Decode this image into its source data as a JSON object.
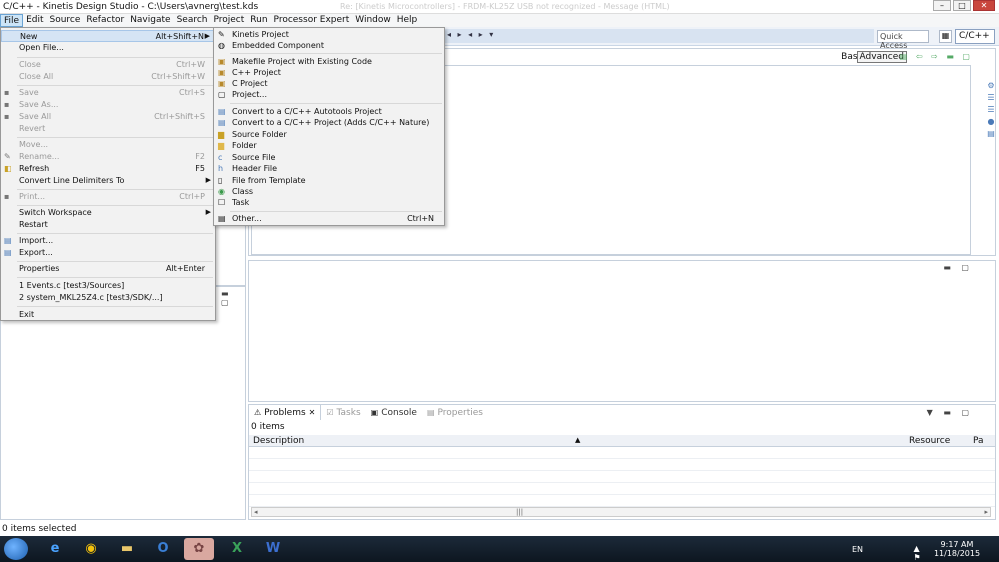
{
  "window": {
    "title": "C/C++ - Kinetis Design Studio - C:\\Users\\avnerg\\test.kds",
    "ghost_text": "Re: [Kinetis Microcontrollers] - FRDM-KL25Z USB not recognized - Message (HTML)",
    "minimize": "–",
    "maximize": "□",
    "close": "✕"
  },
  "menubar": [
    "File",
    "Edit",
    "Source",
    "Refactor",
    "Navigate",
    "Search",
    "Project",
    "Run",
    "Processor Expert",
    "Window",
    "Help"
  ],
  "toolbar": {
    "nav_arrows": "◂ ▸ ◂ ▸ ▾",
    "quick_access": "Quick Access",
    "perspective": "C/C++"
  },
  "file_menu": {
    "items": [
      {
        "label": "New",
        "shortcut": "Alt+Shift+N",
        "submenu": true,
        "enabled": true
      },
      {
        "label": "Open File...",
        "shortcut": "",
        "enabled": true
      },
      {
        "label": "Close",
        "shortcut": "Ctrl+W",
        "enabled": false
      },
      {
        "label": "Close All",
        "shortcut": "Ctrl+Shift+W",
        "enabled": false
      },
      {
        "label": "Save",
        "shortcut": "Ctrl+S",
        "enabled": false
      },
      {
        "label": "Save As...",
        "shortcut": "",
        "enabled": false
      },
      {
        "label": "Save All",
        "shortcut": "Ctrl+Shift+S",
        "enabled": false
      },
      {
        "label": "Revert",
        "shortcut": "",
        "enabled": false
      },
      {
        "label": "Move...",
        "shortcut": "",
        "enabled": false
      },
      {
        "label": "Rename...",
        "shortcut": "F2",
        "enabled": false
      },
      {
        "label": "Refresh",
        "shortcut": "F5",
        "enabled": true
      },
      {
        "label": "Convert Line Delimiters To",
        "shortcut": "",
        "submenu": true,
        "enabled": true
      },
      {
        "label": "Print...",
        "shortcut": "Ctrl+P",
        "enabled": false
      },
      {
        "label": "Switch Workspace",
        "shortcut": "",
        "submenu": true,
        "enabled": true
      },
      {
        "label": "Restart",
        "shortcut": "",
        "enabled": true
      },
      {
        "label": "Import...",
        "shortcut": "",
        "enabled": true
      },
      {
        "label": "Export...",
        "shortcut": "",
        "enabled": true
      },
      {
        "label": "Properties",
        "shortcut": "Alt+Enter",
        "enabled": true
      },
      {
        "label": "1 Events.c  [test3/Sources]",
        "shortcut": "",
        "enabled": true
      },
      {
        "label": "2 system_MKL25Z4.c  [test3/SDK/...]",
        "shortcut": "",
        "enabled": true
      },
      {
        "label": "Exit",
        "shortcut": "",
        "enabled": true
      }
    ]
  },
  "new_submenu": {
    "items": [
      {
        "label": "Kinetis Project",
        "shortcut": "",
        "icon": "wizard-icon"
      },
      {
        "label": "Embedded Component",
        "shortcut": "",
        "icon": "component-icon"
      },
      {
        "label": "Makefile Project with Existing Code",
        "shortcut": "",
        "icon": "makefile-icon"
      },
      {
        "label": "C++ Project",
        "shortcut": "",
        "icon": "cpp-project-icon"
      },
      {
        "label": "C Project",
        "shortcut": "",
        "icon": "c-project-icon"
      },
      {
        "label": "Project...",
        "shortcut": "",
        "icon": "project-icon"
      },
      {
        "label": "Convert to a C/C++ Autotools Project",
        "shortcut": "",
        "icon": "convert-icon"
      },
      {
        "label": "Convert to a C/C++ Project (Adds C/C++ Nature)",
        "shortcut": "",
        "icon": "convert-icon"
      },
      {
        "label": "Source Folder",
        "shortcut": "",
        "icon": "source-folder-icon"
      },
      {
        "label": "Folder",
        "shortcut": "",
        "icon": "folder-icon"
      },
      {
        "label": "Source File",
        "shortcut": "",
        "icon": "source-file-icon"
      },
      {
        "label": "Header File",
        "shortcut": "",
        "icon": "header-file-icon"
      },
      {
        "label": "File from Template",
        "shortcut": "",
        "icon": "template-icon"
      },
      {
        "label": "Class",
        "shortcut": "",
        "icon": "class-icon"
      },
      {
        "label": "Task",
        "shortcut": "",
        "icon": "task-icon"
      },
      {
        "label": "Other...",
        "shortcut": "Ctrl+N",
        "icon": "other-icon"
      }
    ]
  },
  "editor": {
    "basic_label": "Basic",
    "advanced_label": "Advanced"
  },
  "problems_view": {
    "tabs": [
      {
        "label": "Problems",
        "active": true
      },
      {
        "label": "Tasks",
        "active": false
      },
      {
        "label": "Console",
        "active": false
      },
      {
        "label": "Properties",
        "active": false
      }
    ],
    "count": "0 items",
    "columns": [
      "Description",
      "Resource",
      "Pa"
    ]
  },
  "status_bar": {
    "text": "0 items selected"
  },
  "taskbar": {
    "apps": [
      "ie",
      "chrome",
      "explorer",
      "outlook",
      "app",
      "excel",
      "word"
    ],
    "language": "EN",
    "time": "9:17 AM",
    "date": "11/18/2015"
  }
}
